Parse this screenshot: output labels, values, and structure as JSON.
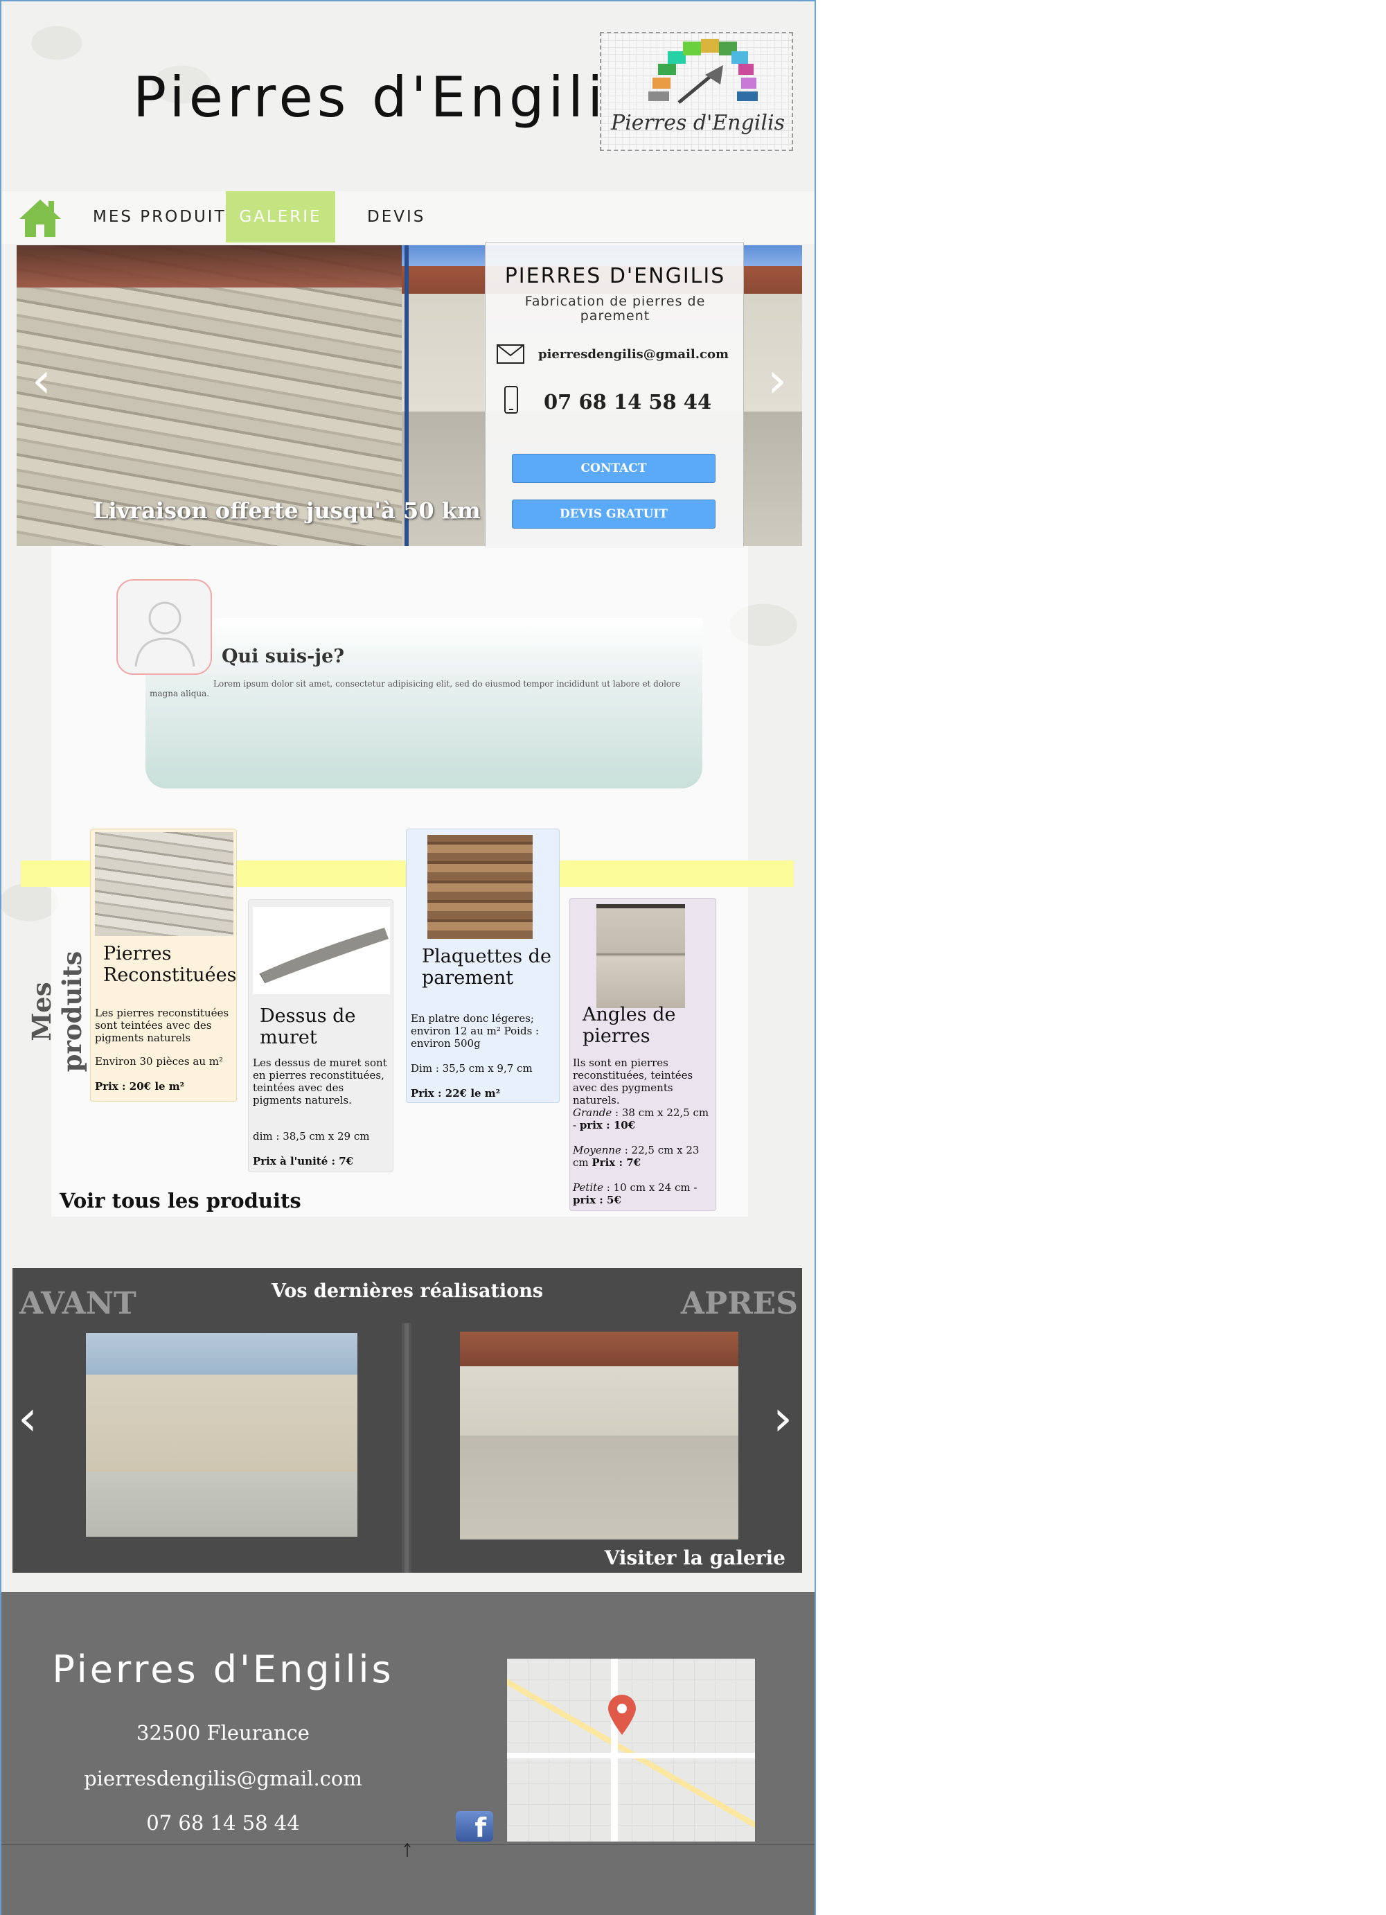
{
  "site_title": "Pierres d'Engilis",
  "logo": {
    "text": "Pierres d'Engilis"
  },
  "nav": {
    "home_icon": "home-icon",
    "items": [
      {
        "label": "MES PRODUITS"
      },
      {
        "label": "GALERIE"
      },
      {
        "label": "DEVIS"
      }
    ]
  },
  "hero": {
    "caption": "Livraison offerte jusqu'à 50 km",
    "prev": "‹",
    "next": "›"
  },
  "contact_card": {
    "title": "PIERRES D'ENGILIS",
    "subtitle": "Fabrication de pierres de parement",
    "email": "pierresdengilis@gmail.com",
    "phone": "07 68 14 58 44",
    "contact_btn": "CONTACT",
    "devis_btn": "DEVIS GRATUIT"
  },
  "about": {
    "title": "Qui suis-je?",
    "text": "Lorem ipsum dolor sit amet, consectetur adipisicing elit, sed do eiusmod tempor incididunt ut labore et dolore magna aliqua."
  },
  "products": {
    "section_label": "Mes produits",
    "link": "Voir tous les produits",
    "items": [
      {
        "name": "Pierres Reconstituées",
        "desc": "Les pierres reconstituées sont teintées avec des pigments naturels",
        "qty": "Environ 30 pièces au m²",
        "price": "Prix : 20€ le m²"
      },
      {
        "name": "Dessus de muret",
        "desc": "Les dessus de muret sont en pierres reconstituées, teintées avec des pigments naturels.",
        "dim": "dim : 38,5 cm x 29 cm",
        "price": "Prix à l'unité : 7€"
      },
      {
        "name": "Plaquettes de parement",
        "desc": "En platre donc légeres; environ 12 au m² Poids : environ 500g",
        "dim": "Dim : 35,5 cm x 9,7 cm",
        "price": "Prix : 22€ le m²"
      },
      {
        "name": "Angles de pierres",
        "desc": "Ils sont en pierres reconstituées, teintées avec des pygments naturels.",
        "grande_label": "Grande",
        "grande": " : 38 cm x 22,5 cm - ",
        "grande_price": "prix : 10€",
        "moyenne_label": "Moyenne",
        "moyenne": " : 22,5 cm x 23 cm ",
        "moyenne_price": "Prix : 7€",
        "petite_label": "Petite",
        "petite": " : 10 cm x 24 cm - ",
        "petite_price": "prix : 5€"
      }
    ]
  },
  "realisations": {
    "title": "Vos dernières réalisations",
    "before": "AVANT",
    "after": "APRES",
    "link": "Visiter la galerie"
  },
  "footer": {
    "title": "Pierres d'Engilis",
    "city": "32500 Fleurance",
    "email": "pierresdengilis@gmail.com",
    "phone": "07 68 14 58 44",
    "facebook": "f"
  },
  "colors": {
    "nav_active": "#c4e482",
    "button": "#5aaaf7",
    "highlight": "#fbfb99",
    "footer": "#6f6f6f",
    "dark_panel": "#4a4a4a"
  }
}
